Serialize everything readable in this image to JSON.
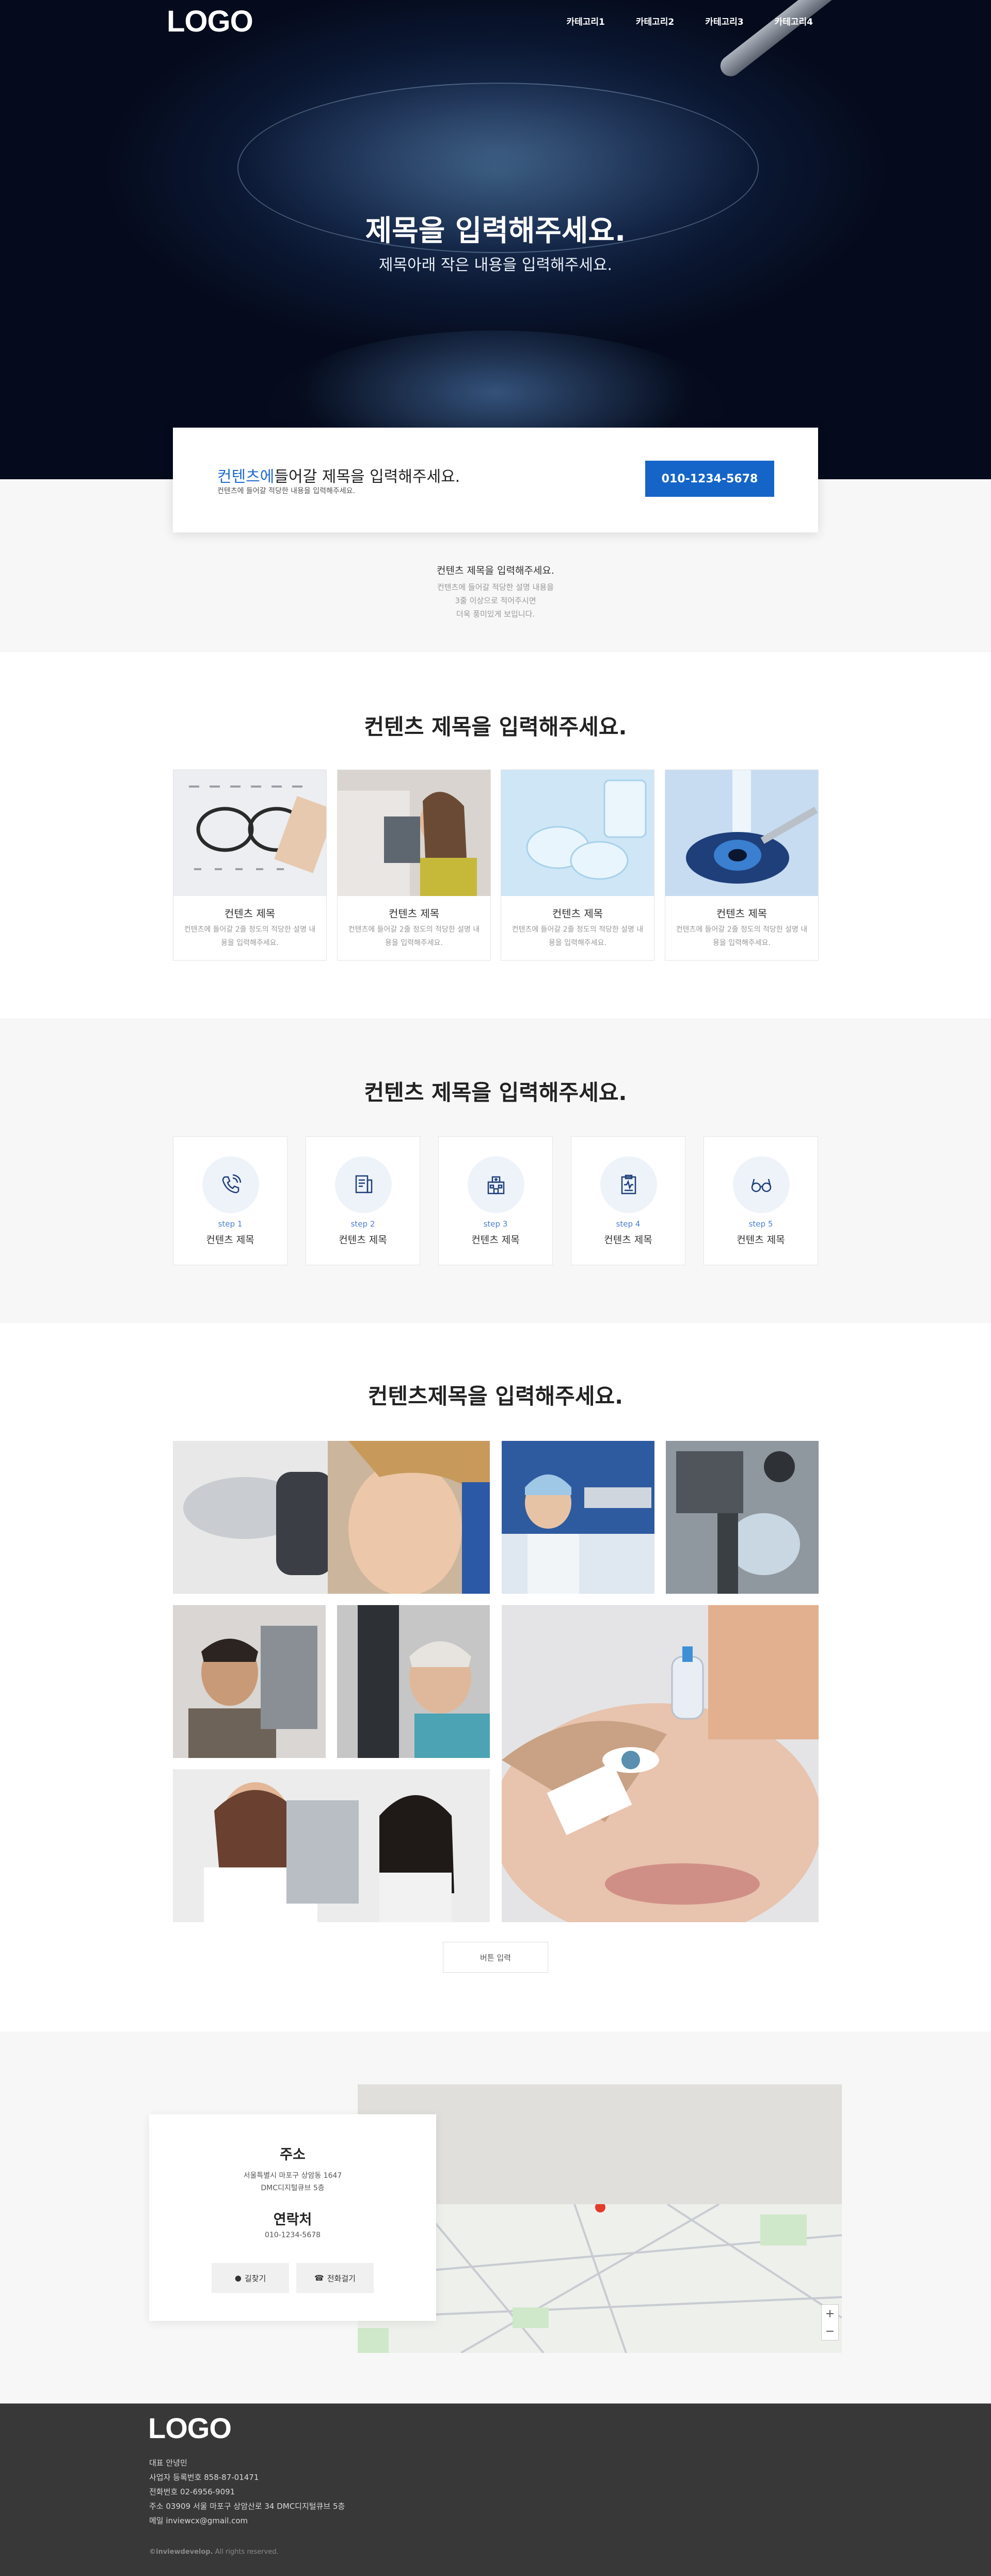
{
  "header": {
    "logo": "LOGO",
    "nav": [
      "카테고리1",
      "카테고리2",
      "카테고리3",
      "카테고리4"
    ]
  },
  "hero": {
    "title": "제목을 입력해주세요.",
    "subtitle": "제목아래 작은 내용을 입력해주세요."
  },
  "contact_bar": {
    "title_highlight": "컨텐츠에",
    "title_rest": "들어갈 제목을 입력해주세요.",
    "subtitle": "컨텐츠에 들어갈 적당한 내용을 입력해주세요.",
    "phone": "010-1234-5678"
  },
  "notice": {
    "heading": "컨텐츠 제목을 입력해주세요.",
    "lines": [
      "컨텐츠에 들어갈 적당한 설명 내용을",
      "3줄 이상으로 적어주시면",
      "더욱 풍미있게 보입니다."
    ]
  },
  "section1": {
    "title": "컨텐츠 제목을 입력해주세요.",
    "cards": [
      {
        "title": "컨텐츠 제목",
        "desc": "컨텐츠에 들어갈 2줄 정도의 적당한 설명 내용을 입력해주세요."
      },
      {
        "title": "컨텐츠 제목",
        "desc": "컨텐츠에 들어갈 2줄 정도의 적당한 설명 내용을 입력해주세요."
      },
      {
        "title": "컨텐츠 제목",
        "desc": "컨텐츠에 들어갈 2줄 정도의 적당한 설명 내용을 입력해주세요."
      },
      {
        "title": "컨텐츠 제목",
        "desc": "컨텐츠에 들어갈 2줄 정도의 적당한 설명 내용을 입력해주세요."
      }
    ]
  },
  "section2": {
    "title": "컨텐츠 제목을 입력해주세요.",
    "steps": [
      {
        "step": "step 1",
        "title": "컨텐츠 제목",
        "icon": "phone-icon"
      },
      {
        "step": "step 2",
        "title": "컨텐츠 제목",
        "icon": "document-icon"
      },
      {
        "step": "step 3",
        "title": "컨텐츠 제목",
        "icon": "hospital-icon"
      },
      {
        "step": "step 4",
        "title": "컨텐츠 제목",
        "icon": "clipboard-icon"
      },
      {
        "step": "step 5",
        "title": "컨텐츠 제목",
        "icon": "glasses-icon"
      }
    ]
  },
  "section3": {
    "title": "컨텐츠제목을 입력해주세요.",
    "more_button": "버튼 입력"
  },
  "location": {
    "address_heading": "주소",
    "address_line1": "서울특별시 마포구 상암동 1647",
    "address_line2": "DMC디지털큐브 5층",
    "contact_heading": "연락처",
    "contact_phone": "010-1234-5678",
    "route_button": "길찾기",
    "call_button": "전화걸기"
  },
  "footer": {
    "logo": "LOGO",
    "lines": [
      "대표 안녕민",
      "사업자 등록번호 858-87-01471",
      "전화번호 02-6956-9091",
      "주소 03909 서울 마포구 상암산로 34 DMC디지털큐브 5층",
      "메일 inviewcx@gmail.com"
    ],
    "copyright_brand": "©inviewdevelop.",
    "copyright_rest": " All rights reserved."
  },
  "colors": {
    "accent": "#1565c8",
    "step_text": "#4a7fd0",
    "footer_bg": "#383838",
    "section_grey": "#f7f7f7"
  }
}
